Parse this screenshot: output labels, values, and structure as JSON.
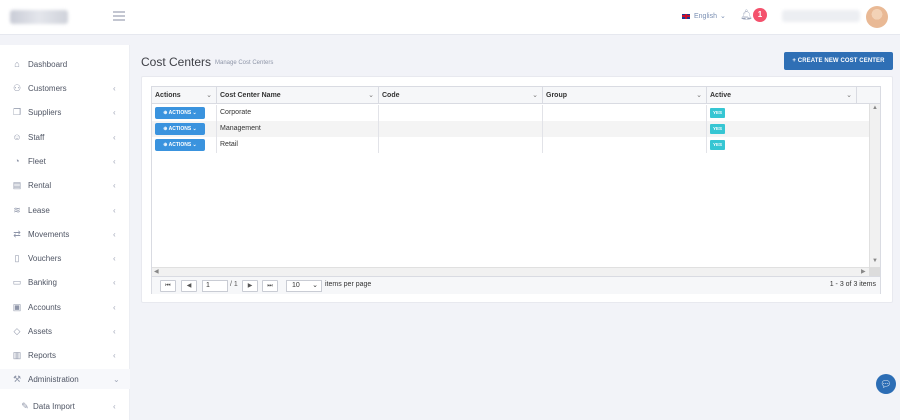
{
  "header": {
    "language": "English",
    "notification_count": "1"
  },
  "sidebar": {
    "items": [
      {
        "label": "Dashboard",
        "icon": "home-icon",
        "chevron": ""
      },
      {
        "label": "Customers",
        "icon": "users-icon",
        "chevron": "‹"
      },
      {
        "label": "Suppliers",
        "icon": "suppliers-icon",
        "chevron": "‹"
      },
      {
        "label": "Staff",
        "icon": "staff-icon",
        "chevron": "‹"
      },
      {
        "label": "Fleet",
        "icon": "gauge-icon",
        "chevron": "‹"
      },
      {
        "label": "Rental",
        "icon": "rental-icon",
        "chevron": "‹"
      },
      {
        "label": "Lease",
        "icon": "layers-icon",
        "chevron": "‹"
      },
      {
        "label": "Movements",
        "icon": "movements-icon",
        "chevron": "‹"
      },
      {
        "label": "Vouchers",
        "icon": "voucher-icon",
        "chevron": "‹"
      },
      {
        "label": "Banking",
        "icon": "bank-icon",
        "chevron": "‹"
      },
      {
        "label": "Accounts",
        "icon": "accounts-icon",
        "chevron": "‹"
      },
      {
        "label": "Assets",
        "icon": "diamond-icon",
        "chevron": "‹"
      },
      {
        "label": "Reports",
        "icon": "bar-chart-icon",
        "chevron": "‹"
      },
      {
        "label": "Administration",
        "icon": "wrench-icon",
        "chevron": "⌄"
      },
      {
        "label": "Data Import",
        "icon": "pencil-icon",
        "chevron": "‹"
      }
    ]
  },
  "page": {
    "title": "Cost Centers",
    "subtitle": "Manage Cost Centers",
    "create_button": "+ CREATE NEW COST CENTER"
  },
  "grid": {
    "columns": [
      "Actions",
      "Cost Center Name",
      "Code",
      "Group",
      "Active"
    ],
    "action_label": "ACTIONS",
    "active_label": "YES",
    "rows": [
      {
        "name": "Corporate",
        "code": "",
        "group": "",
        "active": "YES"
      },
      {
        "name": "Management",
        "code": "",
        "group": "",
        "active": "YES"
      },
      {
        "name": "Retail",
        "code": "",
        "group": "",
        "active": "YES"
      }
    ]
  },
  "pager": {
    "page": "1",
    "of_pages": "/ 1",
    "page_size": "10",
    "items_per_page": "items per page",
    "info": "1 - 3 of 3 items"
  },
  "colors": {
    "primary": "#2f6fb5",
    "action_button": "#3a93de",
    "active_badge": "#36c6d3",
    "notification": "#f4516c"
  }
}
